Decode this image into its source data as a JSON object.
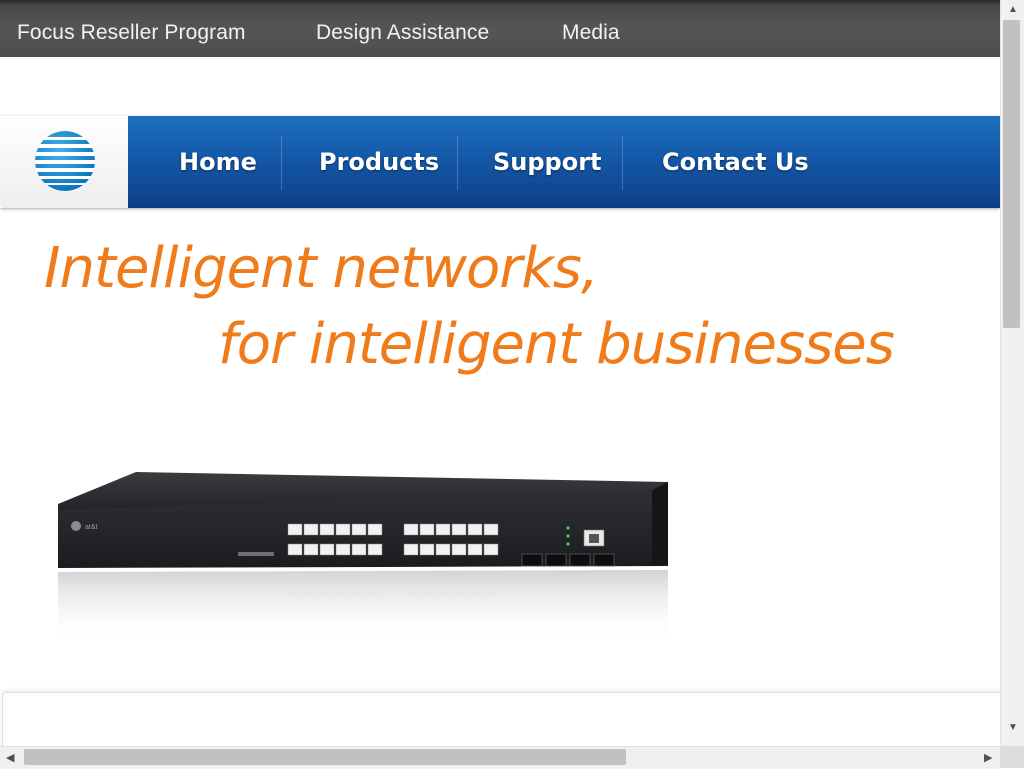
{
  "topbar": {
    "links": [
      "Focus Reseller Program",
      "Design Assistance",
      "Media"
    ]
  },
  "mainnav": {
    "logo_icon": "att-globe-logo",
    "items": [
      "Home",
      "Products",
      "Support",
      "Contact Us"
    ]
  },
  "hero": {
    "line1": "Intelligent networks,",
    "line2": "for intelligent businesses",
    "image": "network-switch-image"
  },
  "colors": {
    "topbar": "#4e4e4e",
    "nav_blue": "#1459a8",
    "hero_orange": "#ef7b1a"
  },
  "scrollbars": {
    "up_icon": "scroll-up-arrow-icon",
    "down_icon": "scroll-down-arrow-icon",
    "left_icon": "scroll-left-arrow-icon",
    "right_icon": "scroll-right-arrow-icon"
  }
}
